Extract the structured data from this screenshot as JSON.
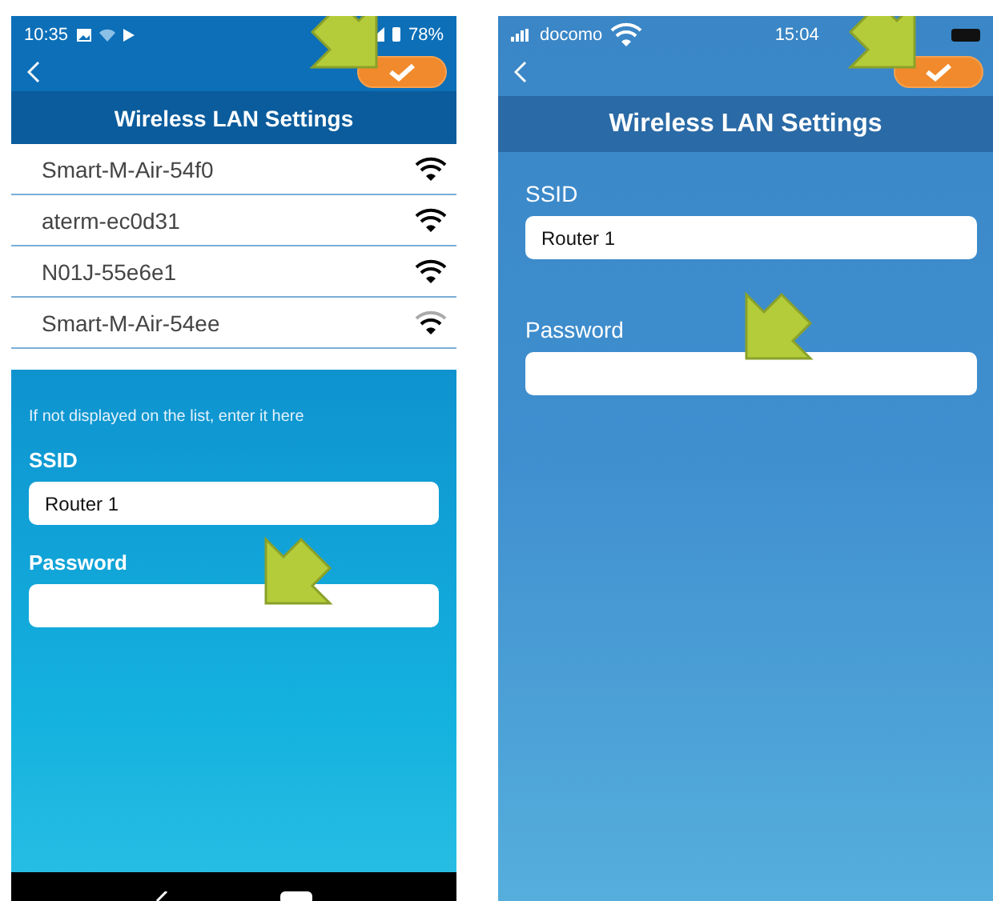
{
  "phones": [
    {
      "kind": "android",
      "status_bar": {
        "time": "10:35",
        "battery": "78%"
      },
      "title": "Wireless LAN Settings",
      "networks": [
        {
          "name": "Smart-M-Air-54f0",
          "weak": false
        },
        {
          "name": "aterm-ec0d31",
          "weak": false
        },
        {
          "name": "N01J-55e6e1",
          "weak": false
        },
        {
          "name": "Smart-M-Air-54ee",
          "weak": true
        }
      ],
      "hint": "If not displayed on the list, enter it here",
      "fields": [
        {
          "label": "SSID",
          "value": "Router 1"
        },
        {
          "label": "Password"
        }
      ]
    },
    {
      "kind": "ios",
      "status_bar": {
        "carrier": "docomo",
        "time": "15:04"
      },
      "title": "Wireless LAN Settings",
      "fields": [
        {
          "label": "SSID",
          "value": "Router 1"
        },
        {
          "label": "Password"
        }
      ]
    }
  ]
}
